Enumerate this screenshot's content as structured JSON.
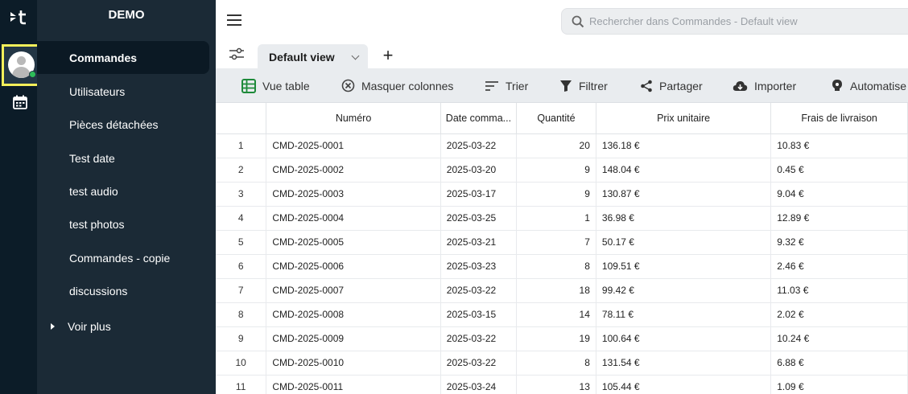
{
  "sidebar": {
    "title": "DEMO",
    "items": [
      {
        "label": "Commandes",
        "active": true
      },
      {
        "label": "Utilisateurs"
      },
      {
        "label": "Pièces détachées"
      },
      {
        "label": "Test date"
      },
      {
        "label": "test audio"
      },
      {
        "label": "test photos"
      },
      {
        "label": "Commandes - copie"
      },
      {
        "label": "discussions"
      }
    ],
    "more_label": "Voir plus"
  },
  "rail": {
    "logo_text": "≥t",
    "icons": [
      "app-logo-icon",
      "avatar-icon",
      "calendar-icon"
    ],
    "status_color": "#2ebd59",
    "highlight_color": "#f5ef5a"
  },
  "search": {
    "placeholder": "Rechercher dans Commandes - Default view"
  },
  "tabs": [
    {
      "label": "Default view"
    }
  ],
  "toolbar": {
    "table_view": "Vue table",
    "hide_columns": "Masquer colonnes",
    "sort": "Trier",
    "filter": "Filtrer",
    "share": "Partager",
    "import": "Importer",
    "automate": "Automatise"
  },
  "table": {
    "columns": [
      "",
      "Numéro",
      "Date comma...",
      "Quantité",
      "Prix unitaire",
      "Frais de livraison"
    ],
    "rows": [
      [
        "1",
        "CMD-2025-0001",
        "2025-03-22",
        "20",
        "136.18 €",
        "10.83 €"
      ],
      [
        "2",
        "CMD-2025-0002",
        "2025-03-20",
        "9",
        "148.04 €",
        "0.45 €"
      ],
      [
        "3",
        "CMD-2025-0003",
        "2025-03-17",
        "9",
        "130.87 €",
        "9.04 €"
      ],
      [
        "4",
        "CMD-2025-0004",
        "2025-03-25",
        "1",
        "36.98 €",
        "12.89 €"
      ],
      [
        "5",
        "CMD-2025-0005",
        "2025-03-21",
        "7",
        "50.17 €",
        "9.32 €"
      ],
      [
        "6",
        "CMD-2025-0006",
        "2025-03-23",
        "8",
        "109.51 €",
        "2.46 €"
      ],
      [
        "7",
        "CMD-2025-0007",
        "2025-03-22",
        "18",
        "99.42 €",
        "11.03 €"
      ],
      [
        "8",
        "CMD-2025-0008",
        "2025-03-15",
        "14",
        "78.11 €",
        "2.02 €"
      ],
      [
        "9",
        "CMD-2025-0009",
        "2025-03-22",
        "19",
        "100.64 €",
        "10.24 €"
      ],
      [
        "10",
        "CMD-2025-0010",
        "2025-03-22",
        "8",
        "131.54 €",
        "6.88 €"
      ],
      [
        "11",
        "CMD-2025-0011",
        "2025-03-24",
        "13",
        "105.44 €",
        "1.09 €"
      ]
    ]
  }
}
